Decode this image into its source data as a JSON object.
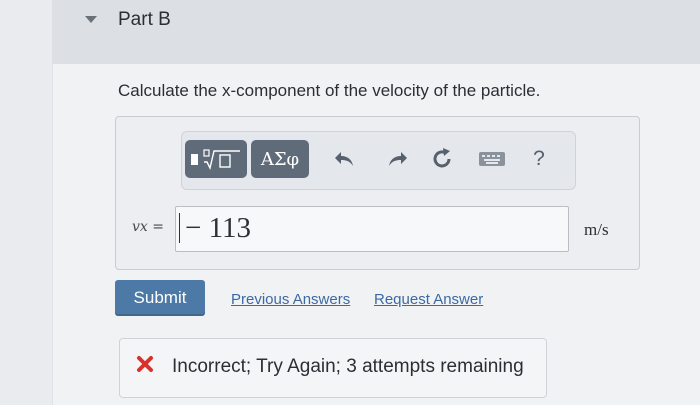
{
  "part": {
    "title": "Part B"
  },
  "question": {
    "text": "Calculate the x-component of the velocity of the particle."
  },
  "toolbar": {
    "templates_icon": "fraction-radical-templates-icon",
    "symbols_label": "ΑΣφ",
    "undo_icon": "undo-icon",
    "redo_icon": "redo-icon",
    "reset_icon": "reset-icon",
    "keyboard_icon": "keyboard-icon",
    "help_label": "?"
  },
  "answer": {
    "variable_label": "vx =",
    "value": "− 113",
    "unit": "m/s"
  },
  "actions": {
    "submit_label": "Submit",
    "previous_answers_label": "Previous Answers",
    "request_answer_label": "Request Answer"
  },
  "feedback": {
    "icon": "red-x-icon",
    "text": "Incorrect; Try Again; 3 attempts remaining"
  },
  "colors": {
    "submit_button": "#4d79a6",
    "link": "#3d69a3",
    "toolbar_button": "#5f6b78",
    "error": "#d9302b"
  }
}
